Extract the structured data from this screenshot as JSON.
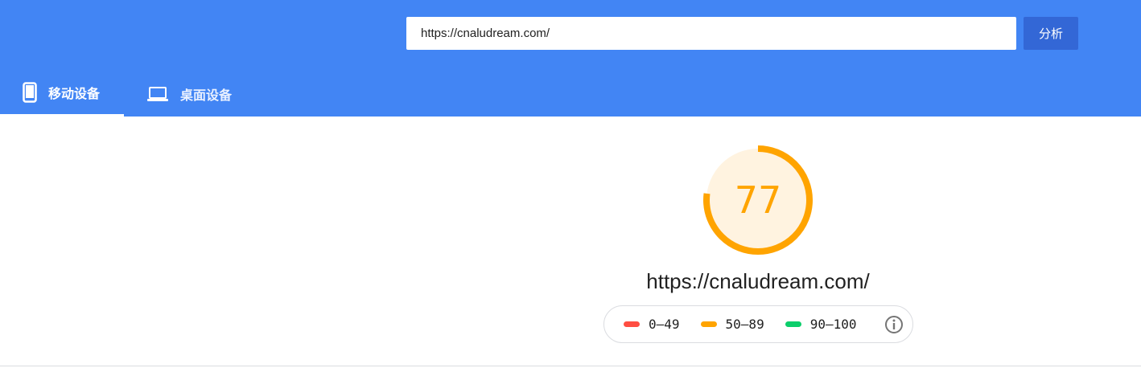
{
  "search": {
    "url_value": "https://cnaludream.com/",
    "analyze_label": "分析"
  },
  "tabs": [
    {
      "label": "移动设备",
      "icon": "phone-icon",
      "active": true
    },
    {
      "label": "桌面设备",
      "icon": "laptop-icon",
      "active": false
    }
  ],
  "score": {
    "value": "77",
    "fraction": 0.77,
    "color": "#ffa400",
    "bg_color": "#fff3e0"
  },
  "page_url": "https://cnaludream.com/",
  "legend": [
    {
      "label": "0–49",
      "color": "#ff4e42"
    },
    {
      "label": "50–89",
      "color": "#ffa400"
    },
    {
      "label": "90–100",
      "color": "#0cce6b"
    }
  ],
  "colors": {
    "header_bg": "#4285f4",
    "button_bg": "#3367d6"
  },
  "icons": {
    "info": "info-icon"
  }
}
